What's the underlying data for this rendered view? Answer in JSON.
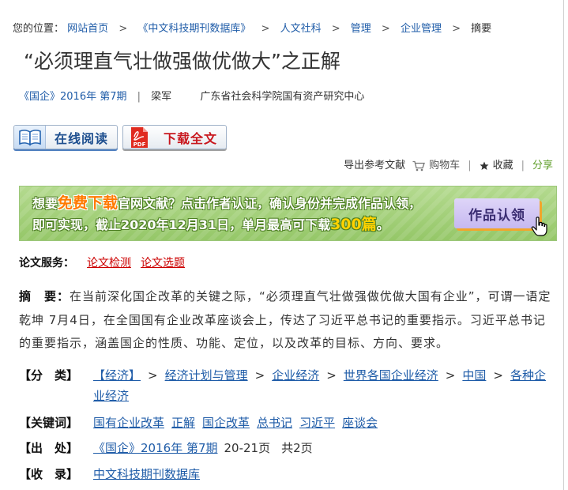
{
  "theme": {
    "link": "#1f5ca8",
    "service_link": "#cc0000",
    "share": "#5f9e2a",
    "text": "#333333",
    "banner_green": "#a5d17c",
    "highlight_orange": "#ff7a00",
    "highlight_yellow": "#ffd200",
    "claim_button": "#c6b9f0"
  },
  "breadcrumb": {
    "prefix": "您的位置：",
    "separator": ">",
    "items": [
      "网站首页",
      "《中文科技期刊数据库》",
      "人文社科",
      "管理",
      "企业管理"
    ],
    "current": "摘要"
  },
  "article": {
    "title": "“必须理直气壮做强做优做大”之正解",
    "source": "《国企》2016年 第7期",
    "separator": "|",
    "author": "梁军",
    "organization": "广东省社会科学院国有资产研究中心"
  },
  "actions": {
    "read_online": "在线阅读",
    "read_icon": "book-icon",
    "download": "下载全文",
    "download_icon": "pdf-icon",
    "pdf_badge": "PDF"
  },
  "toolbar": {
    "export": "导出参考文献",
    "cart": "购物车",
    "cart_icon": "cart-icon",
    "separator": "|",
    "favorite": "收藏",
    "favorite_icon": "star-icon",
    "share": "分享"
  },
  "banner": {
    "line1": {
      "before": "想要",
      "highlight": "免费下载",
      "after": "官网文献？点击作者认证，确认身份并完成作品认领，"
    },
    "line2": {
      "before": "即可实现，截止2020年12月31日，单月最高可下载",
      "highlight": "300篇",
      "after": "。"
    },
    "button": "作品认领",
    "cursor_icon": "hand-pointer-icon"
  },
  "service": {
    "label": "论文服务：",
    "links": [
      "论文检测",
      "论文选题"
    ]
  },
  "abstract": {
    "label": "摘　要：",
    "text": "在当前深化国企改革的关键之际，“必须理直气壮做强做优做大国有企业”，可谓一语定乾坤 7月4日，在全国国有企业改革座谈会上，传达了习近平总书记的重要指示。习近平总书记的重要指示，涵盖国企的性质、功能、定位，以及改革的目标、方向、要求。"
  },
  "details": {
    "category": {
      "label": "【分　类】",
      "separator": ">",
      "items": [
        "【经济】",
        "经济计划与管理",
        "企业经济",
        "世界各国企业经济",
        "中国",
        "各种企业经济"
      ]
    },
    "keywords": {
      "label": "【关键词】",
      "items": [
        "国有企业改革",
        "正解",
        "国企改革",
        "总书记",
        "习近平",
        "座谈会"
      ]
    },
    "source": {
      "label": "【出　处】",
      "journal_issue": "《国企》2016年 第7期",
      "pages": "20-21页",
      "page_count": "共2页"
    },
    "indexed": {
      "label": "【收　录】",
      "database": "中文科技期刊数据库"
    }
  }
}
